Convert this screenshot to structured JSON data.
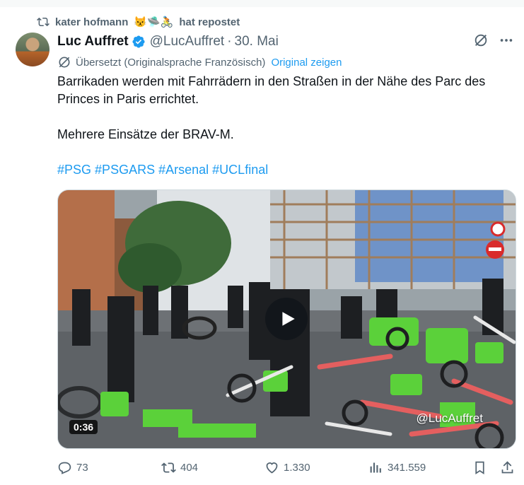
{
  "repost": {
    "user": "kater hofmann",
    "emojis": "😾🛸🚴",
    "suffix": "hat repostet"
  },
  "author": {
    "name": "Luc Auffret",
    "handle": "@LucAuffret",
    "separator": "·",
    "date": "30. Mai"
  },
  "translation": {
    "note": "Übersetzt (Originalsprache Französisch)",
    "show_original": "Original zeigen"
  },
  "tweet": {
    "line1": "Barrikaden werden mit Fahrrädern in den Straßen in der Nähe des Parc des Princes in Paris errichtet.",
    "line2": "Mehrere Einsätze der BRAV-M.",
    "hashtags": [
      "#PSG",
      "#PSGARS",
      "#Arsenal",
      "#UCLfinal"
    ]
  },
  "media": {
    "duration": "0:36",
    "watermark": "@LucAuffret"
  },
  "actions": {
    "replies": "73",
    "reposts": "404",
    "likes": "1.330",
    "views": "341.559"
  },
  "colors": {
    "accent": "#1d9bf0",
    "muted": "#536471",
    "text": "#0f1419",
    "lime": "#5bd13a"
  }
}
